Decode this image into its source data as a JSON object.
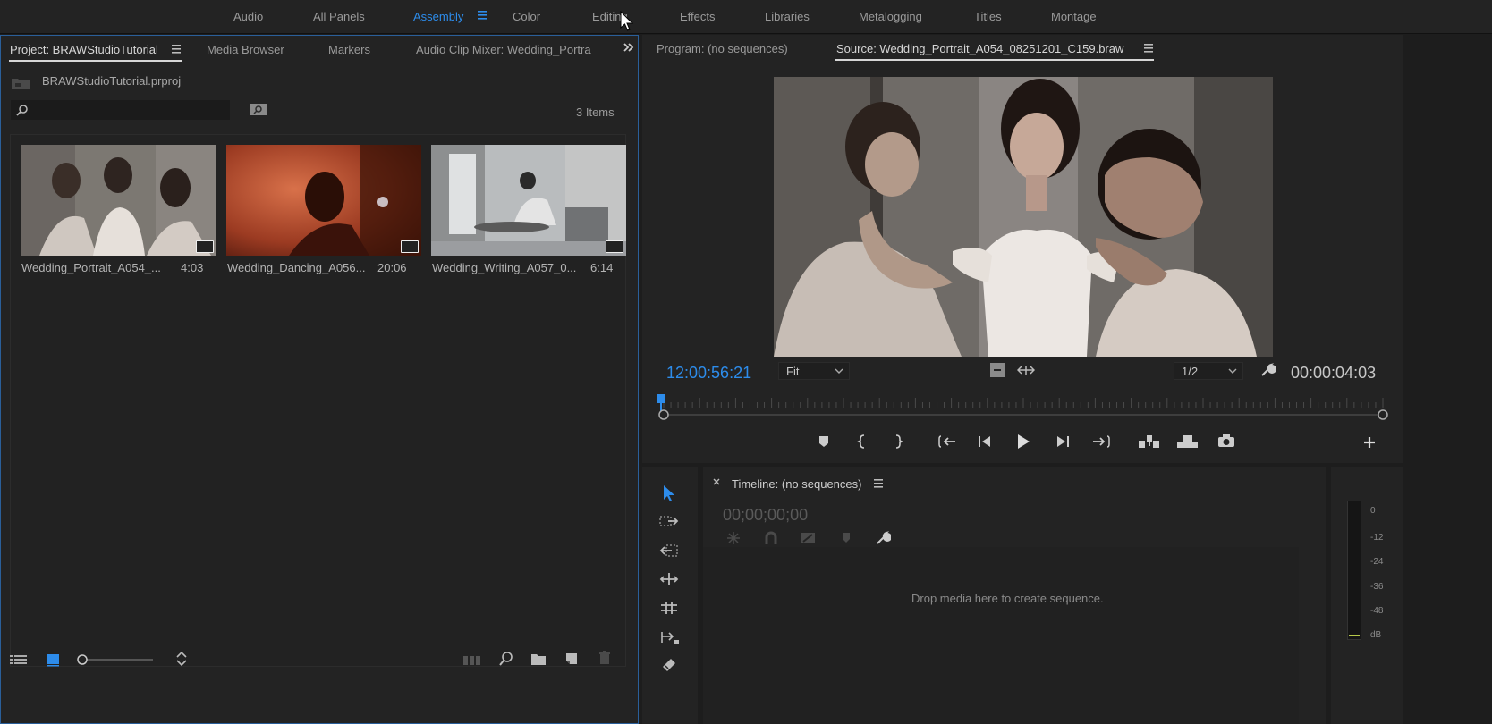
{
  "workspaces": {
    "tabs": [
      "Audio",
      "All Panels",
      "Assembly",
      "Color",
      "Editing",
      "Effects",
      "Libraries",
      "Metalogging",
      "Titles",
      "Montage"
    ],
    "active": "Assembly",
    "active_color": "#2d8ceb"
  },
  "project_panel": {
    "tabs": [
      "Project: BRAWStudioTutorial",
      "Media Browser",
      "Markers",
      "Audio Clip Mixer: Wedding_Portra"
    ],
    "file_name": "BRAWStudioTutorial.prproj",
    "search_placeholder": "",
    "item_count": "3 Items",
    "clips": [
      {
        "name": "Wedding_Portrait_A054_...",
        "duration": "4:03"
      },
      {
        "name": "Wedding_Dancing_A056...",
        "duration": "20:06"
      },
      {
        "name": "Wedding_Writing_A057_0...",
        "duration": "6:14"
      }
    ]
  },
  "monitor": {
    "tabs": [
      "Program: (no sequences)",
      "Source: Wedding_Portrait_A054_08251201_C159.braw"
    ],
    "current_timecode": "12:00:56:21",
    "zoom": "Fit",
    "resolution": "1/2",
    "duration_timecode": "00:00:04:03"
  },
  "timeline": {
    "title": "Timeline: (no sequences)",
    "timecode": "00;00;00;00",
    "drop_hint": "Drop media here to create sequence."
  },
  "audio_meter": {
    "labels": [
      "0",
      "-12",
      "-24",
      "-36",
      "-48",
      "dB"
    ]
  }
}
